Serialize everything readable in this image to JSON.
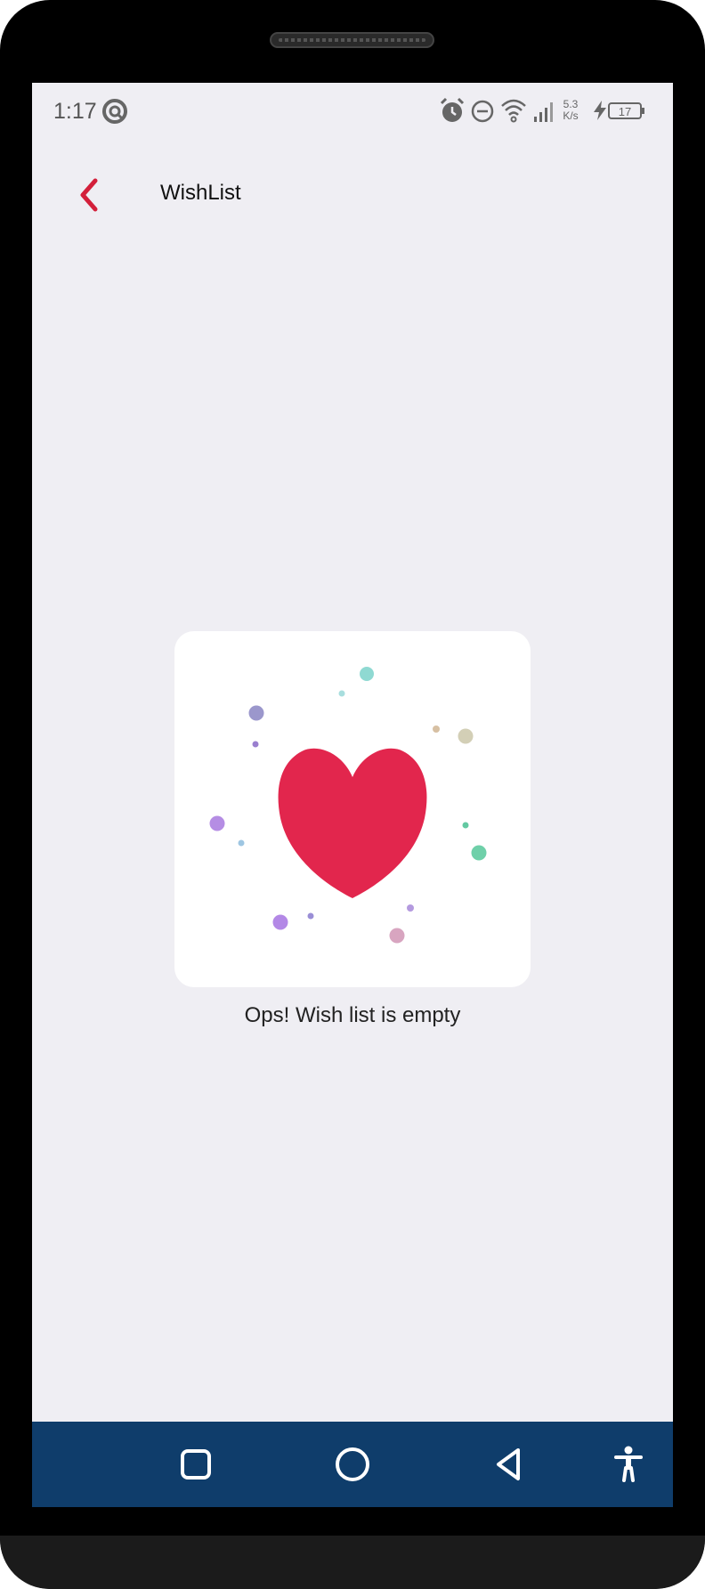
{
  "status_bar": {
    "time": "1:17",
    "net_speed_value": "5.3",
    "net_speed_unit": "K/s",
    "battery": "17",
    "icons": [
      "app-notification-icon",
      "alarm-icon",
      "do-not-disturb-icon",
      "wifi-icon",
      "signal-icon",
      "net-speed",
      "charging-icon",
      "battery-icon"
    ]
  },
  "appbar": {
    "title": "WishList",
    "back_icon": "chevron-left-icon",
    "accent_color": "#d31f3a"
  },
  "empty_state": {
    "illustration": "heart-icon",
    "heart_color": "#e2264d",
    "message": "Ops! Wish list is empty"
  },
  "nav_bar": {
    "background": "#0f3d6b",
    "buttons": [
      "recents-square-icon",
      "home-circle-icon",
      "back-triangle-icon",
      "accessibility-icon"
    ]
  }
}
